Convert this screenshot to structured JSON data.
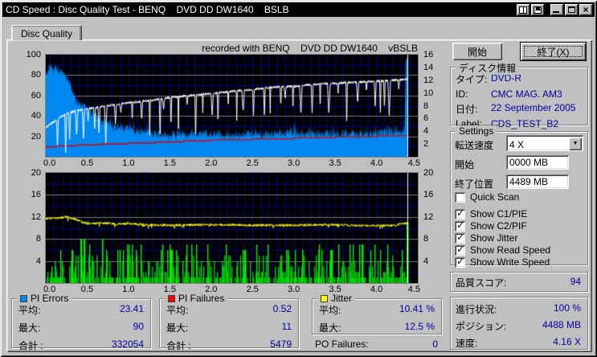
{
  "window": {
    "title": "CD Speed : Disc Quality Test - BENQ    DVD DD DW1640    BSLB",
    "titlebar_buttons": [
      "report-icon",
      "save-icon",
      "minimize",
      "maximize",
      "close"
    ]
  },
  "tab": {
    "label": "Disc Quality"
  },
  "colors": {
    "value_text": "#0000a0",
    "pi_errors": "#0087f0",
    "pi_failures": "#ff0000",
    "jitter": "#ffff00",
    "green_bars": "#00c800",
    "grid_minor": "#000080",
    "grid_major": "#787878",
    "read_speed_line": "#dd0000",
    "write_speed_line": "#ffffff"
  },
  "chart_data": [
    {
      "name": "quality-top",
      "type": "area",
      "title": "recorded with BENQ    DVD DD DW1640    vBSLB",
      "x_min": 0,
      "x_max": 4.5,
      "data_end": 4.375,
      "x_tick_labels": [
        "0.0",
        "0.5",
        "1.0",
        "1.5",
        "2.0",
        "2.5",
        "3.0",
        "3.5",
        "4.0",
        "4.5"
      ],
      "left_axis": {
        "min": 0,
        "max": 100,
        "ticks": [
          100,
          80,
          60,
          40,
          20
        ],
        "minor": [
          10,
          30,
          50,
          70,
          90
        ],
        "major": [
          20,
          40,
          60,
          80
        ]
      },
      "right_axis": {
        "min": 0,
        "max": 16,
        "ticks": [
          16,
          14,
          12,
          10,
          8,
          6,
          4,
          2
        ]
      },
      "series": {
        "pi_errors_area": {
          "color": "#0087f0",
          "noise": 5,
          "seed": 7,
          "points": [
            [
              0,
              80
            ],
            [
              0.05,
              88
            ],
            [
              0.15,
              82
            ],
            [
              0.25,
              78
            ],
            [
              0.3,
              70
            ],
            [
              0.35,
              58
            ],
            [
              0.4,
              52
            ],
            [
              0.5,
              46
            ],
            [
              0.6,
              40
            ],
            [
              0.7,
              34
            ],
            [
              0.8,
              31
            ],
            [
              0.9,
              29
            ],
            [
              1.0,
              27
            ],
            [
              1.1,
              25
            ],
            [
              1.3,
              23
            ],
            [
              1.5,
              21
            ],
            [
              1.8,
              22
            ],
            [
              2.0,
              23
            ],
            [
              2.2,
              21
            ],
            [
              2.5,
              22
            ],
            [
              2.8,
              23
            ],
            [
              3.0,
              24
            ],
            [
              3.2,
              22
            ],
            [
              3.5,
              23
            ],
            [
              3.8,
              22
            ],
            [
              4.0,
              23
            ],
            [
              4.2,
              24
            ],
            [
              4.3,
              25
            ],
            [
              4.34,
              26
            ],
            [
              4.355,
              96
            ],
            [
              4.375,
              96
            ]
          ]
        },
        "write_speed": {
          "color": "#ffffff",
          "noise": 1.2,
          "seed": 3,
          "points": [
            [
              0,
              29
            ],
            [
              0.2,
              40
            ],
            [
              0.35,
              45
            ],
            [
              0.5,
              47
            ],
            [
              0.75,
              50
            ],
            [
              1.0,
              53
            ],
            [
              1.25,
              55
            ],
            [
              1.5,
              58
            ],
            [
              1.75,
              60
            ],
            [
              2.0,
              62
            ],
            [
              2.25,
              64
            ],
            [
              2.5,
              66
            ],
            [
              2.75,
              68
            ],
            [
              3.0,
              69
            ],
            [
              3.25,
              71
            ],
            [
              3.5,
              72
            ],
            [
              3.75,
              73
            ],
            [
              4.0,
              74
            ],
            [
              4.2,
              75
            ],
            [
              4.375,
              76
            ]
          ],
          "dips": {
            "start": 0.05,
            "min_gap": 0.04,
            "max_gap": 0.14,
            "min_depth": 8,
            "max_depth": 42,
            "seed": 11
          }
        },
        "read_speed": {
          "color": "#dd0000",
          "seed": 5,
          "points": [
            [
              0,
              10
            ],
            [
              0.5,
              12
            ],
            [
              1.0,
              13.5
            ],
            [
              1.5,
              15
            ],
            [
              2.0,
              16.5
            ],
            [
              2.5,
              17.5
            ],
            [
              3.0,
              18.5
            ],
            [
              3.5,
              19.5
            ],
            [
              4.0,
              20.5
            ],
            [
              4.375,
              21.5
            ]
          ]
        }
      },
      "cursor_x": 4.375
    },
    {
      "name": "quality-bottom",
      "type": "bar",
      "x_min": 0,
      "x_max": 4.5,
      "data_end": 4.375,
      "x_tick_labels": [
        "0.0",
        "0.5",
        "1.0",
        "1.5",
        "2.0",
        "2.5",
        "3.0",
        "3.5",
        "4.0",
        "4.5"
      ],
      "left_axis": {
        "min": 0,
        "max": 20,
        "ticks": [
          20,
          16,
          12,
          8,
          4
        ],
        "minor": [
          2,
          6,
          10,
          14,
          18
        ],
        "major": [
          4,
          8,
          12,
          16
        ]
      },
      "right_axis": {
        "min": 0,
        "max": 20,
        "ticks": [
          20,
          16,
          12,
          8,
          4
        ]
      },
      "series": {
        "pi_failures_bars": {
          "color": "#00c800",
          "density": 0.5,
          "max": 8,
          "seed": 13,
          "extra_spikes": [
            [
              0.42,
              8
            ],
            [
              0.46,
              8
            ],
            [
              0.68,
              8
            ],
            [
              1.52,
              6
            ],
            [
              2.4,
              6
            ],
            [
              3.1,
              6
            ]
          ],
          "end_spike": [
            4.36,
            11
          ]
        },
        "jitter": {
          "color": "#ffff00",
          "noise": 0.22,
          "seed": 9,
          "points": [
            [
              0,
              11.7
            ],
            [
              0.15,
              11.8
            ],
            [
              0.25,
              12.0
            ],
            [
              0.35,
              11.6
            ],
            [
              0.45,
              11.0
            ],
            [
              0.55,
              10.8
            ],
            [
              0.7,
              10.9
            ],
            [
              0.85,
              10.7
            ],
            [
              1.0,
              10.8
            ],
            [
              1.2,
              10.6
            ],
            [
              1.5,
              10.5
            ],
            [
              2.0,
              10.6
            ],
            [
              2.5,
              10.5
            ],
            [
              3.0,
              10.5
            ],
            [
              3.5,
              10.6
            ],
            [
              3.8,
              10.4
            ],
            [
              4.0,
              10.4
            ],
            [
              4.2,
              10.5
            ],
            [
              4.375,
              10.9
            ]
          ]
        }
      },
      "cursor_x": 4.375
    }
  ],
  "stats": {
    "pi_errors": {
      "title": "PI Errors",
      "swatch": "#0087f0",
      "rows": [
        {
          "label": "平均:",
          "value": "23.41"
        },
        {
          "label": "最大:",
          "value": "90"
        },
        {
          "label": "合計 :",
          "value": "332054"
        }
      ]
    },
    "pi_failures": {
      "title": "PI Failures",
      "swatch": "#ff0000",
      "rows": [
        {
          "label": "平均:",
          "value": "0.52"
        },
        {
          "label": "最大:",
          "value": "11"
        },
        {
          "label": "合計 :",
          "value": "5479"
        }
      ]
    },
    "jitter": {
      "title": "Jitter",
      "swatch": "#ffff00",
      "rows": [
        {
          "label": "平均:",
          "value": "10.41 %"
        },
        {
          "label": "最大:",
          "value": "12.5 %"
        }
      ]
    },
    "po_failures": {
      "label": "PO Failures:",
      "value": "0"
    }
  },
  "side": {
    "start_button": "開始",
    "exit_button": "終了(X)",
    "disc_info": {
      "title": "ディスク情報",
      "rows": [
        {
          "label": "タイプ:",
          "value": "DVD-R"
        },
        {
          "label": "ID:",
          "value": "CMC MAG. AM3"
        },
        {
          "label": "日付:",
          "value": "22 September 2005"
        },
        {
          "label": "Label:",
          "value": "CDS_TEST_B2"
        }
      ]
    },
    "settings": {
      "title": "Settings",
      "speed_label": "転送速度",
      "speed_value": "4 X",
      "start_label": "開始",
      "start_value": "0000 MB",
      "end_label": "終了位置",
      "end_value": "4489 MB",
      "checkboxes": [
        {
          "label": "Quick Scan",
          "checked": false
        },
        {
          "label": "Show C1/PIE",
          "checked": true
        },
        {
          "label": "Show C2/PIF",
          "checked": true
        },
        {
          "label": "Show Jitter",
          "checked": true
        },
        {
          "label": "Show Read Speed",
          "checked": true
        },
        {
          "label": "Show Write Speed",
          "checked": true
        }
      ]
    },
    "quality": {
      "label": "品質スコア:",
      "value": "94"
    },
    "progress": {
      "rows": [
        {
          "label": "進行状況:",
          "value": "100 %"
        },
        {
          "label": "ポジション:",
          "value": "4488 MB"
        },
        {
          "label": "速度:",
          "value": "4.16 X"
        }
      ]
    }
  }
}
